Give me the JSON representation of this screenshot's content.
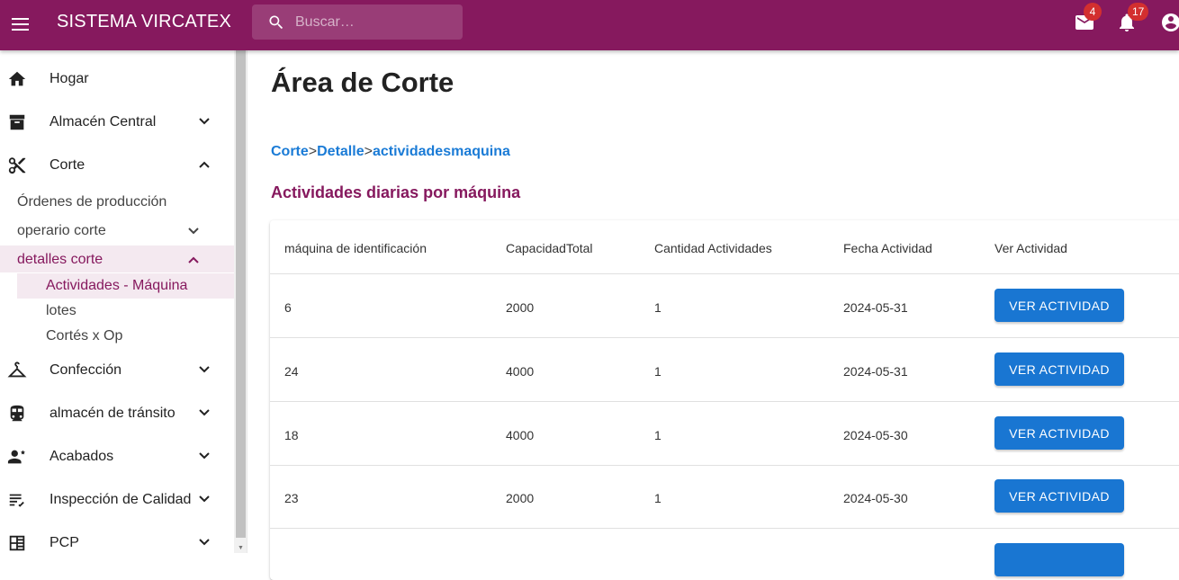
{
  "header": {
    "title": "SISTEMA VIRCATEX",
    "search_placeholder": "Buscar…",
    "mail_count": "4",
    "notification_count": "17",
    "colors": {
      "appbar": "#86195e",
      "badge": "#d32f2f"
    }
  },
  "sidebar": {
    "items": [
      {
        "label": "Hogar",
        "icon": "home-icon"
      },
      {
        "label": "Almacén Central",
        "icon": "archive-icon",
        "expanded": false
      },
      {
        "label": "Corte",
        "icon": "scissors-icon",
        "expanded": true
      },
      {
        "label": "Confección",
        "icon": "hanger-icon",
        "expanded": false
      },
      {
        "label": "almacén de tránsito",
        "icon": "train-icon",
        "expanded": false
      },
      {
        "label": "Acabados",
        "icon": "worker-icon",
        "expanded": false
      },
      {
        "label": "Inspección de Calidad",
        "icon": "checklist-icon",
        "expanded": false
      },
      {
        "label": "PCP",
        "icon": "panel-icon",
        "expanded": false
      }
    ],
    "corte_children": [
      {
        "label": "Órdenes de producción"
      },
      {
        "label": "operario corte",
        "expanded": false
      },
      {
        "label": "detalles corte",
        "expanded": true
      }
    ],
    "detalles_children": [
      {
        "label": "Actividades - Máquina",
        "active": true
      },
      {
        "label": "lotes"
      },
      {
        "label": "Cortés x Op"
      }
    ]
  },
  "main": {
    "page_title": "Área de Corte",
    "breadcrumb": {
      "crumb1": "Corte",
      "sep1": ">",
      "crumb2": "Detalle",
      "sep2": ">",
      "crumb3": "actividadesmaquina"
    },
    "section_title": "Actividades diarias por máquina",
    "table": {
      "columns": [
        "máquina de identificación",
        "CapacidadTotal",
        "Cantidad Actividades",
        "Fecha Actividad",
        "Ver Actividad"
      ],
      "button_label": "VER ACTIVIDAD",
      "rows": [
        [
          "6",
          "2000",
          "1",
          "2024-05-31"
        ],
        [
          "24",
          "4000",
          "1",
          "2024-05-31"
        ],
        [
          "18",
          "4000",
          "1",
          "2024-05-30"
        ],
        [
          "23",
          "2000",
          "1",
          "2024-05-30"
        ]
      ]
    }
  }
}
